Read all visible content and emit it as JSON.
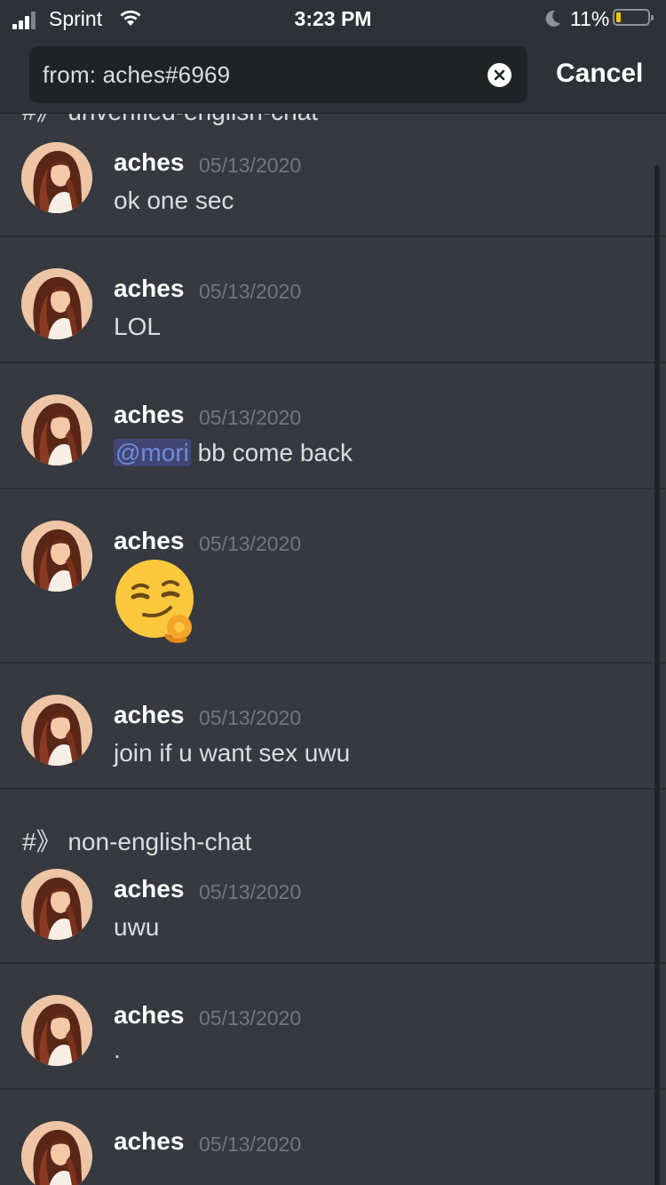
{
  "status_bar": {
    "carrier": "Sprint",
    "time": "3:23 PM",
    "battery": "11%",
    "battery_level": 0.11
  },
  "search": {
    "query": "from: aches#6969",
    "cancel_label": "Cancel"
  },
  "channels": {
    "top_partial": "#》 unverified-english-chat",
    "second": "#》 non-english-chat"
  },
  "messages": [
    {
      "author": "aches",
      "date": "05/13/2020",
      "text": "ok one sec"
    },
    {
      "author": "aches",
      "date": "05/13/2020",
      "text": "LOL"
    },
    {
      "author": "aches",
      "date": "05/13/2020",
      "mention": "@mori",
      "text": " bb come back"
    },
    {
      "author": "aches",
      "date": "05/13/2020",
      "emoji": "smirk-ok-hand-emoji"
    },
    {
      "author": "aches",
      "date": "05/13/2020",
      "text": "join if u want sex uwu"
    },
    {
      "author": "aches",
      "date": "05/13/2020",
      "text": "uwu"
    },
    {
      "author": "aches",
      "date": "05/13/2020",
      "text": "."
    },
    {
      "author": "aches",
      "date": "05/13/2020",
      "text": ""
    }
  ]
}
